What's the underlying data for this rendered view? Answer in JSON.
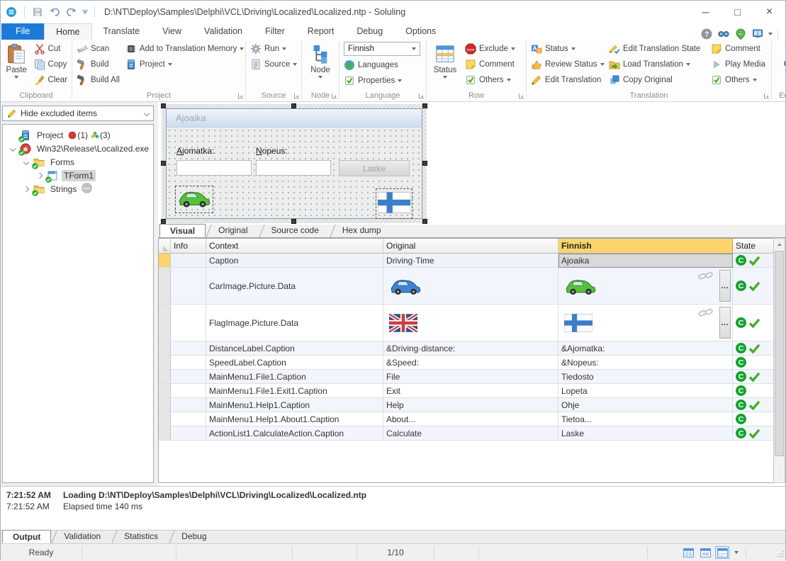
{
  "titlebar": {
    "title": "D:\\NT\\Deploy\\Samples\\Delphi\\VCL\\Driving\\Localized\\Localized.ntp  -  Soluling"
  },
  "tabs": {
    "items": [
      "File",
      "Home",
      "Translate",
      "View",
      "Validation",
      "Filter",
      "Report",
      "Debug",
      "Options"
    ],
    "active": "Home"
  },
  "ribbon": {
    "clipboard": {
      "label": "Clipboard",
      "paste": "Paste",
      "cut": "Cut",
      "copy": "Copy",
      "clear": "Clear"
    },
    "project": {
      "label": "Project",
      "scan": "Scan",
      "build": "Build",
      "build_all": "Build All",
      "add_tm": "Add to Translation Memory",
      "project_btn": "Project"
    },
    "source": {
      "label": "Source",
      "run": "Run",
      "source_btn": "Source"
    },
    "node": {
      "label": "Node",
      "node_btn": "Node"
    },
    "language": {
      "label": "Language",
      "selected": "Finnish",
      "languages": "Languages",
      "properties": "Properties"
    },
    "row": {
      "label": "Row",
      "status": "Status",
      "exclude": "Exclude",
      "comment": "Comment",
      "others": "Others"
    },
    "translation": {
      "label": "Translation",
      "status": "Status",
      "review_status": "Review Status",
      "edit_translation": "Edit Translation",
      "edit_state": "Edit Translation State",
      "load": "Load Translation",
      "copy_original": "Copy Original",
      "comment": "Comment",
      "play_media": "Play Media",
      "others": "Others"
    },
    "editing": {
      "label": "Editing"
    }
  },
  "sidebar": {
    "filter": "Hide excluded items",
    "tree": [
      {
        "label": "Project",
        "icon": "project",
        "indent": 0,
        "expander": "none",
        "badges": [
          {
            "icon": "record",
            "text": "(1)"
          },
          {
            "icon": "flower",
            "text": "(3)"
          }
        ]
      },
      {
        "label": "Win32\\Release\\Localized.exe",
        "icon": "exe",
        "indent": 0,
        "expander": "down"
      },
      {
        "label": "Forms",
        "icon": "folder",
        "indent": 1,
        "expander": "down"
      },
      {
        "label": "TForm1",
        "icon": "form",
        "indent": 2,
        "expander": "right",
        "selected": true
      },
      {
        "label": "Strings",
        "icon": "folder",
        "indent": 1,
        "expander": "right",
        "stop": true
      }
    ]
  },
  "designer": {
    "form_title": "Ajoaika",
    "distance_label": "Ajomatka:",
    "speed_label": "Nopeus:",
    "calc_button": "Laske",
    "images": [
      "car-green",
      "flag-fi"
    ]
  },
  "view_tabs": {
    "items": [
      "Visual",
      "Original",
      "Source code",
      "Hex dump"
    ],
    "active": "Visual"
  },
  "grid": {
    "columns": [
      "Info",
      "Context",
      "Original",
      "Finnish",
      "State"
    ],
    "selected_column": "Finnish",
    "rows": [
      {
        "context": "Caption",
        "original": "Driving·Time",
        "finnish": "Ajoaika",
        "selected": true,
        "state": "C",
        "check": true
      },
      {
        "context": "CarImage.Picture.Data",
        "original_icon": "car-blue",
        "finnish_icon": "car-green",
        "linked": true,
        "state": "C",
        "check": true
      },
      {
        "context": "FlagImage.Picture.Data",
        "original_icon": "flag-uk",
        "finnish_icon": "flag-fi",
        "linked": true,
        "state": "C",
        "check": true
      },
      {
        "context": "DistanceLabel.Caption",
        "original": "&Driving·distance:",
        "finnish": "&Ajomatka:",
        "state": "C",
        "check": true
      },
      {
        "context": "SpeedLabel.Caption",
        "original": "&Speed:",
        "finnish": "&Nopeus:",
        "state": "C",
        "check": false
      },
      {
        "context": "MainMenu1.File1.Caption",
        "original": "File",
        "finnish": "Tiedosto",
        "state": "C",
        "check": true
      },
      {
        "context": "MainMenu1.File1.Exit1.Caption",
        "original": "Exit",
        "finnish": "Lopeta",
        "state": "C",
        "check": false
      },
      {
        "context": "MainMenu1.Help1.Caption",
        "original": "Help",
        "finnish": "Ohje",
        "state": "C",
        "check": true
      },
      {
        "context": "MainMenu1.Help1.About1.Caption",
        "original": "About...",
        "finnish": "Tietoa...",
        "state": "C",
        "check": false
      },
      {
        "context": "ActionList1.CalculateAction.Caption",
        "original": "Calculate",
        "finnish": "Laske",
        "state": "C",
        "check": true
      }
    ]
  },
  "output": {
    "lines": [
      {
        "time": "7:21:52 AM",
        "text": "Loading D:\\NT\\Deploy\\Samples\\Delphi\\VCL\\Driving\\Localized\\Localized.ntp",
        "bold": true
      },
      {
        "time": "7:21:52 AM",
        "text": "Elapsed time 140 ms",
        "bold": false
      }
    ],
    "tabs": [
      "Output",
      "Validation",
      "Statistics",
      "Debug"
    ],
    "active_tab": "Output"
  },
  "statusbar": {
    "ready": "Ready",
    "position": "1/10"
  },
  "colors": {
    "accent_blue": "#1d7bd8",
    "selected_column": "#fbd56b",
    "state_green": "#12a32e",
    "check_green": "#44b021"
  }
}
